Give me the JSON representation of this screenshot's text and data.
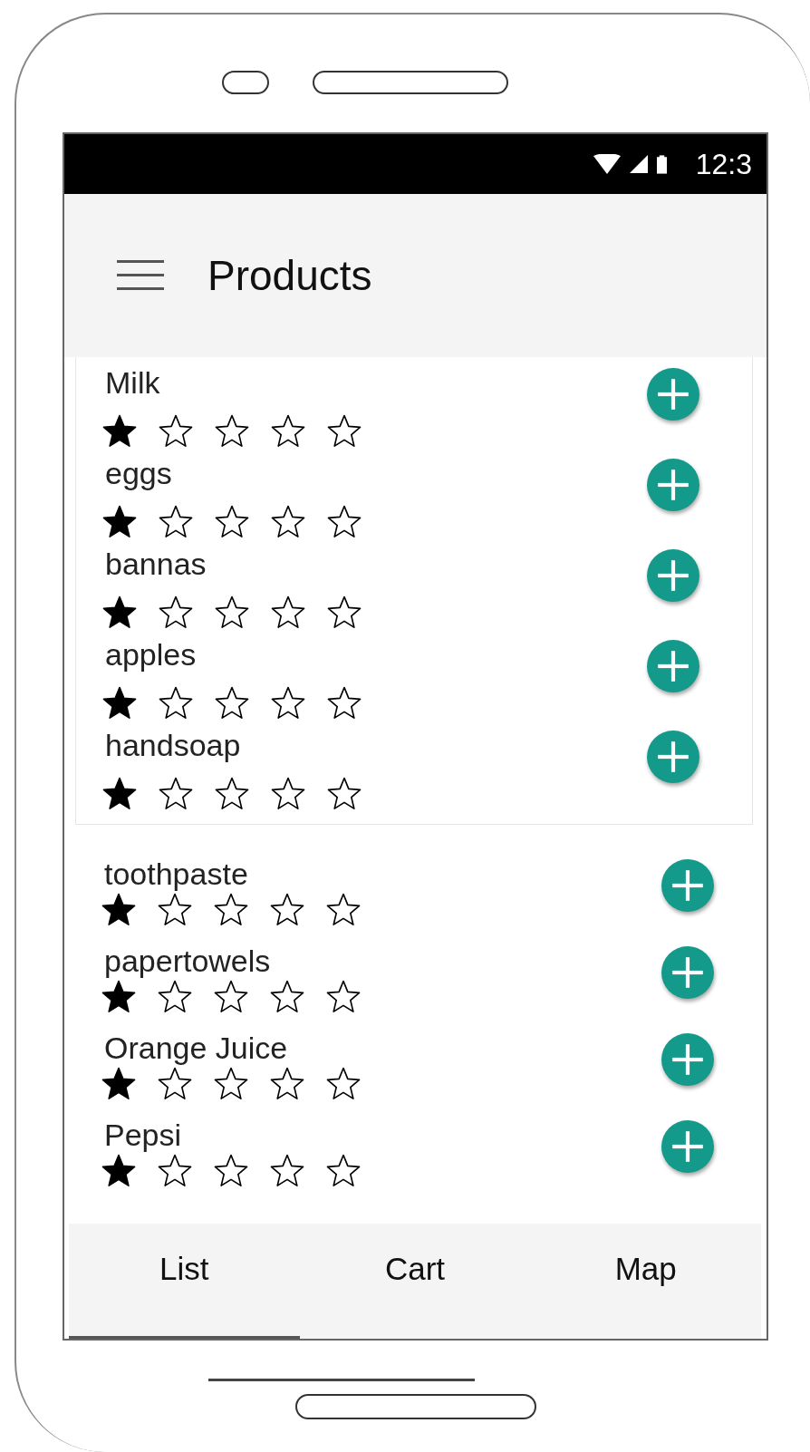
{
  "status_bar": {
    "time": "12:3"
  },
  "app_bar": {
    "title": "Products"
  },
  "products": [
    {
      "name": "Milk",
      "stars": 1,
      "in_card": true
    },
    {
      "name": "eggs",
      "stars": 1,
      "in_card": true
    },
    {
      "name": "bannas",
      "stars": 1,
      "in_card": true
    },
    {
      "name": "apples",
      "stars": 1,
      "in_card": true
    },
    {
      "name": "handsoap",
      "stars": 1,
      "in_card": true
    },
    {
      "name": "toothpaste",
      "stars": 1,
      "in_card": false
    },
    {
      "name": "papertowels",
      "stars": 1,
      "in_card": false
    },
    {
      "name": "Orange Juice",
      "stars": 1,
      "in_card": false
    },
    {
      "name": "Pepsi",
      "stars": 1,
      "in_card": false
    }
  ],
  "tabs": [
    {
      "label": "List",
      "selected": true
    },
    {
      "label": "Cart",
      "selected": false
    },
    {
      "label": "Map",
      "selected": false
    }
  ]
}
